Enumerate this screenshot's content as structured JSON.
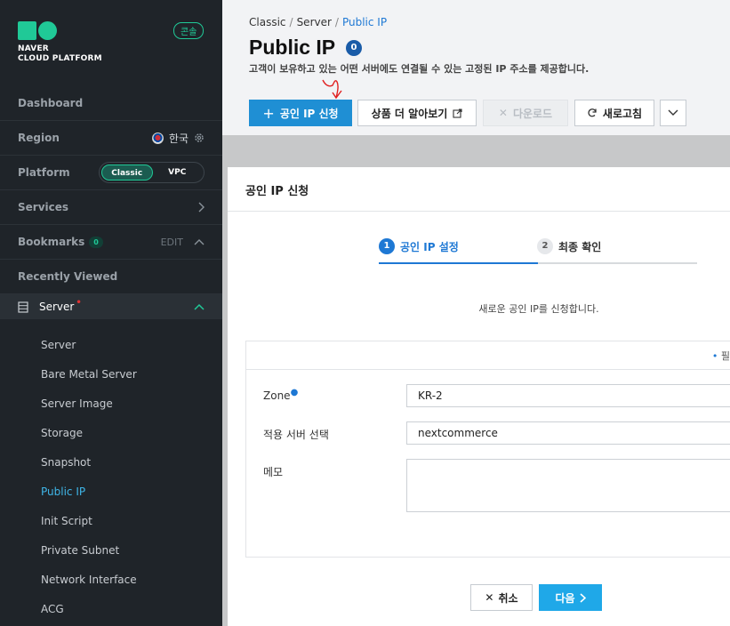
{
  "sidebar": {
    "logo_line1": "NAVER",
    "logo_line2": "CLOUD PLATFORM",
    "console_badge": "콘솔",
    "dashboard": "Dashboard",
    "region": {
      "label": "Region",
      "value": "한국"
    },
    "platform": {
      "label": "Platform",
      "options": [
        "Classic",
        "VPC"
      ],
      "selected": "Classic"
    },
    "services": "Services",
    "bookmarks": {
      "label": "Bookmarks",
      "count": "0",
      "edit": "EDIT"
    },
    "recently_viewed": "Recently Viewed",
    "server_group": "Server",
    "server_items": [
      "Server",
      "Bare Metal Server",
      "Server Image",
      "Storage",
      "Snapshot",
      "Public IP",
      "Init Script",
      "Private Subnet",
      "Network Interface",
      "ACG"
    ],
    "active_item": "Public IP"
  },
  "header": {
    "breadcrumb": [
      "Classic",
      "Server",
      "Public IP"
    ],
    "title": "Public IP",
    "count": "0",
    "subtitle": "고객이 보유하고 있는 어떤 서버에도 연결될 수 있는 고정된 IP 주소를 제공합니다."
  },
  "toolbar": {
    "create": "공인 IP 신청",
    "learn_more": "상품 더 알아보기",
    "download": "다운로드",
    "refresh": "새로고침"
  },
  "modal": {
    "title": "공인 IP 신청",
    "steps": [
      {
        "num": "1",
        "label": "공인 IP 설정"
      },
      {
        "num": "2",
        "label": "최종 확인"
      }
    ],
    "current_step": 1,
    "description": "새로운 공인 IP를 신청합니다.",
    "required_note": "필",
    "fields": {
      "zone": {
        "label": "Zone",
        "value": "KR-2"
      },
      "server": {
        "label": "적용 서버 선택",
        "value": "nextcommerce"
      },
      "memo": {
        "label": "메모",
        "value": ""
      }
    },
    "cancel": "취소",
    "next": "다음"
  },
  "colors": {
    "accent": "#1e78d4",
    "brand": "#20c997",
    "primary_button": "#1f8fd4",
    "annotation": "#e02020"
  }
}
